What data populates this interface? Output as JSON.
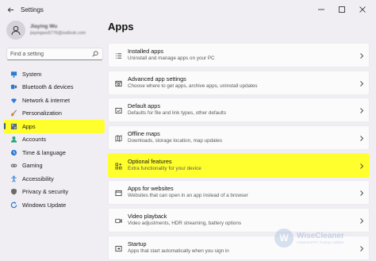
{
  "window": {
    "title": "Settings"
  },
  "profile": {
    "name": "Jiaying Wu",
    "email": "jiayingwu5776@outlook.com"
  },
  "search": {
    "placeholder": "Find a setting"
  },
  "sidebar": {
    "items": [
      {
        "label": "System",
        "icon": "monitor-icon",
        "color": "#2b7bd6"
      },
      {
        "label": "Bluetooth & devices",
        "icon": "bluetooth-icon",
        "color": "#2b7bd6"
      },
      {
        "label": "Network & internet",
        "icon": "wifi-icon",
        "color": "#2b7bd6"
      },
      {
        "label": "Personalization",
        "icon": "brush-icon",
        "color": "#d98a2b"
      },
      {
        "label": "Apps",
        "icon": "apps-grid-icon",
        "color": "#5a6a82",
        "active": true
      },
      {
        "label": "Accounts",
        "icon": "person-icon",
        "color": "#2aa37a"
      },
      {
        "label": "Time & language",
        "icon": "globe-clock-icon",
        "color": "#2b7bd6"
      },
      {
        "label": "Gaming",
        "icon": "gamepad-icon",
        "color": "#7a7a7a"
      },
      {
        "label": "Accessibility",
        "icon": "accessibility-icon",
        "color": "#2b7bd6"
      },
      {
        "label": "Privacy & security",
        "icon": "shield-icon",
        "color": "#6a6a6a"
      },
      {
        "label": "Windows Update",
        "icon": "update-icon",
        "color": "#2b7bd6"
      }
    ]
  },
  "main": {
    "title": "Apps",
    "cards": [
      {
        "title": "Installed apps",
        "desc": "Uninstall and manage apps on your PC",
        "icon": "list-icon"
      },
      {
        "title": "Advanced app settings",
        "desc": "Choose where to get apps, archive apps, uninstall updates",
        "icon": "app-settings-icon"
      },
      {
        "title": "Default apps",
        "desc": "Defaults for file and link types, other defaults",
        "icon": "default-apps-icon"
      },
      {
        "title": "Offline maps",
        "desc": "Downloads, storage location, map updates",
        "icon": "map-icon"
      },
      {
        "title": "Optional features",
        "desc": "Extra functionality for your device",
        "icon": "add-feature-icon",
        "highlight": true
      },
      {
        "title": "Apps for websites",
        "desc": "Websites that can open in an app instead of a browser",
        "icon": "web-apps-icon"
      },
      {
        "title": "Video playback",
        "desc": "Video adjustments, HDR streaming, battery options",
        "icon": "video-icon"
      },
      {
        "title": "Startup",
        "desc": "Apps that start automatically when you sign in",
        "icon": "startup-icon"
      }
    ]
  },
  "watermark": {
    "name": "WiseCleaner",
    "sub": "Advanced PC Tuneup Utilities"
  },
  "colors": {
    "highlight": "#ffff2e",
    "background": "#f0eef3",
    "card": "#fbfbfc"
  }
}
